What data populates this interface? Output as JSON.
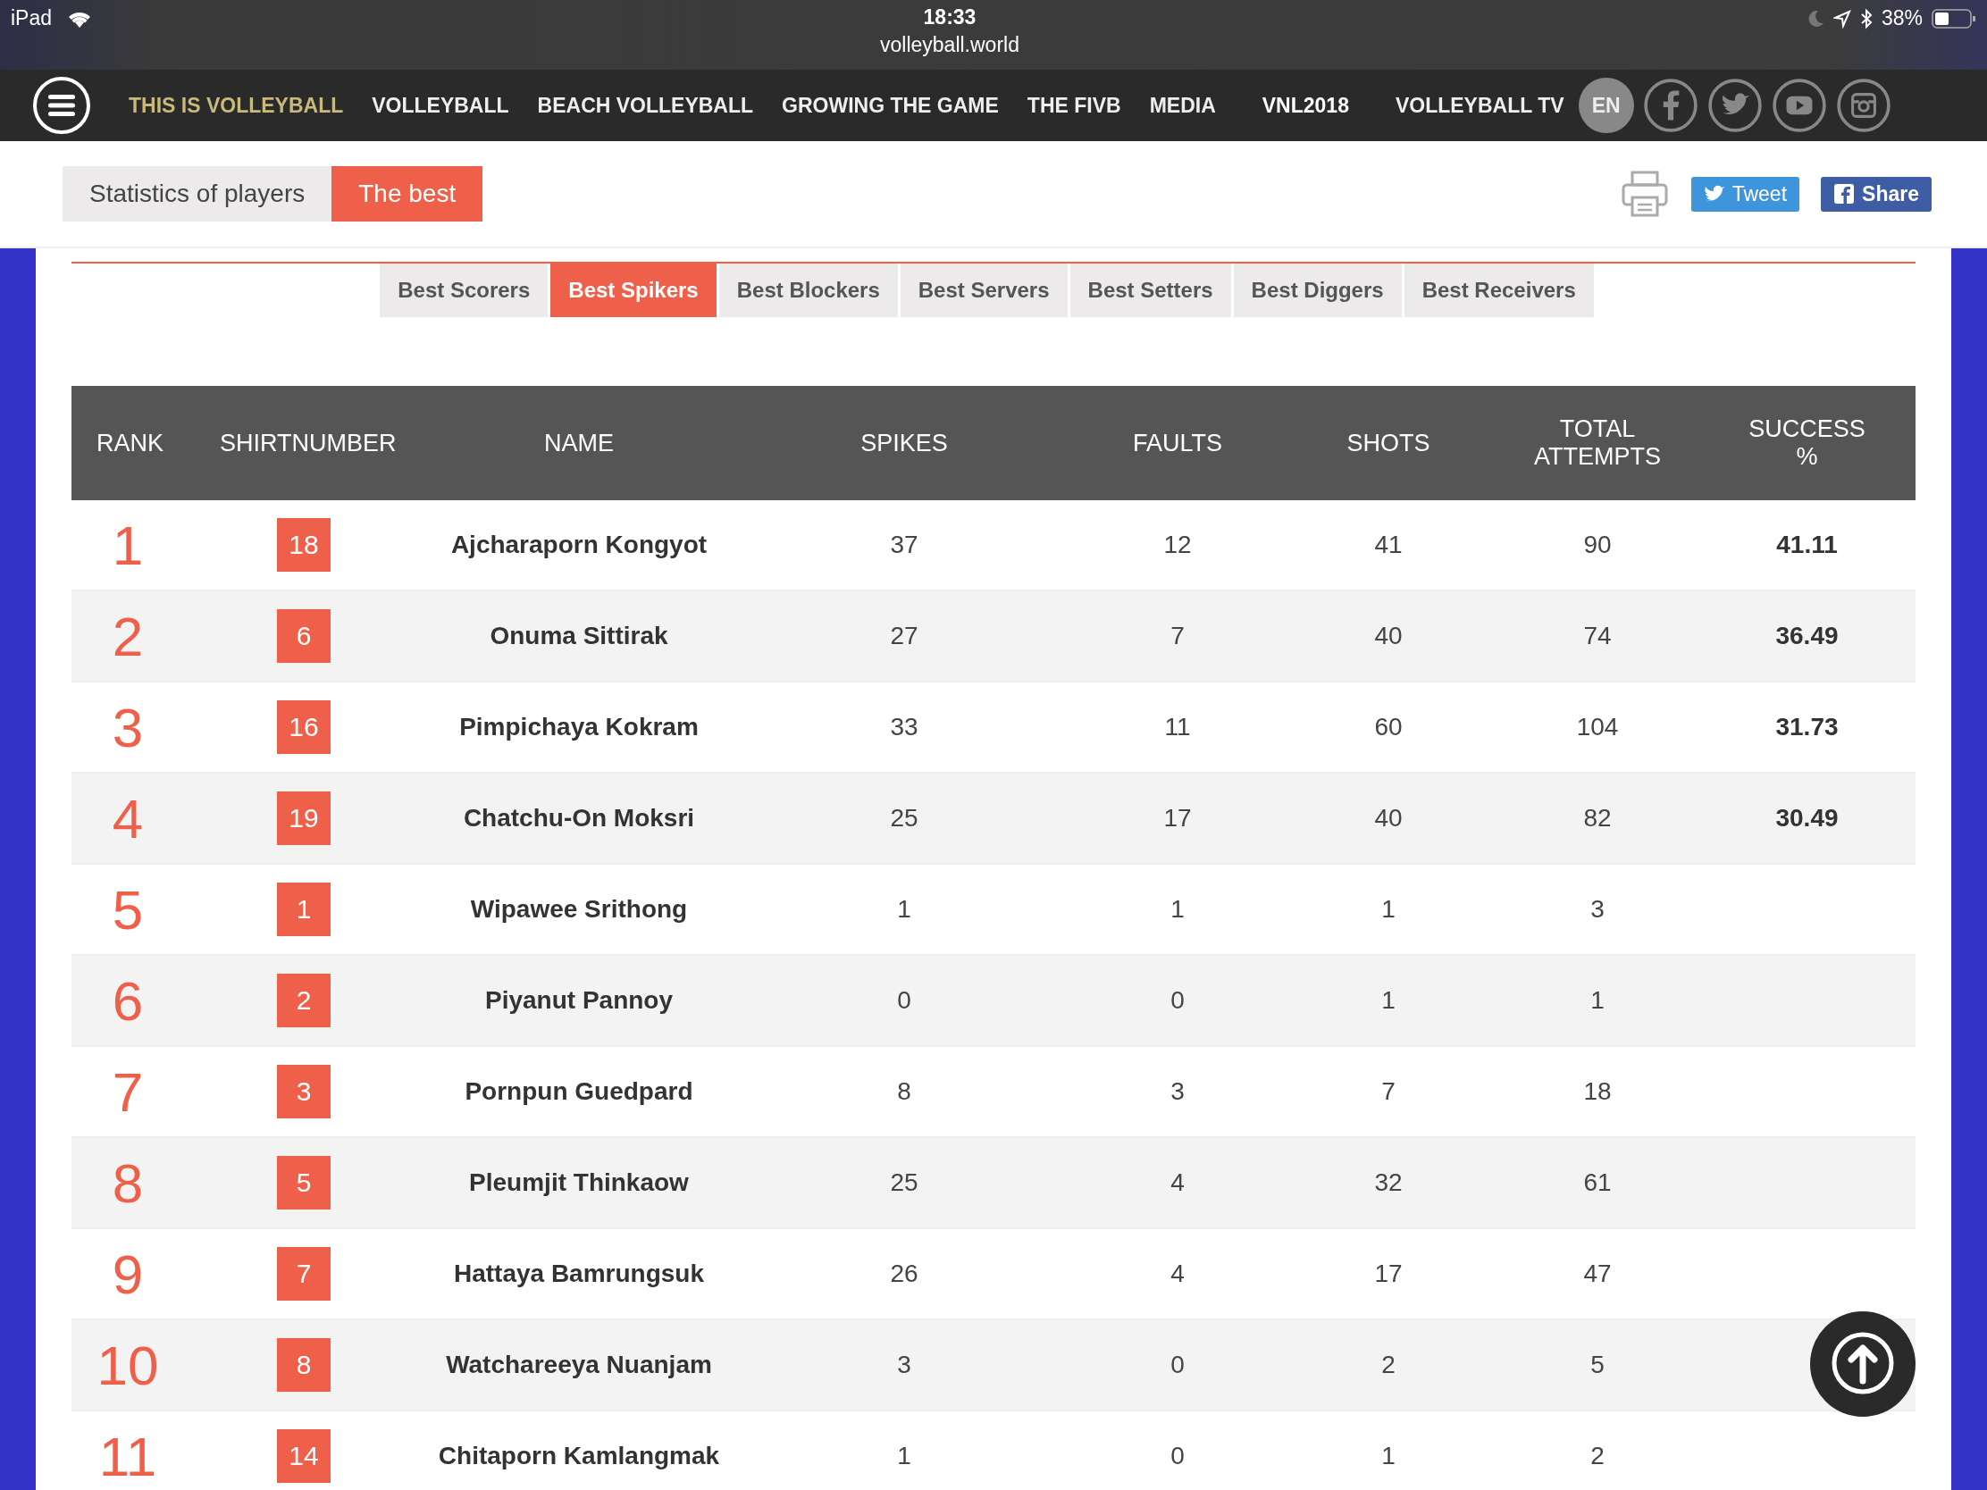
{
  "status_bar": {
    "device": "iPad",
    "time": "18:33",
    "url": "volleyball.world",
    "battery": "38%"
  },
  "nav": {
    "logo": "THIS IS VOLLEYBALL",
    "items": [
      "VOLLEYBALL",
      "BEACH VOLLEYBALL",
      "GROWING THE GAME",
      "THE FIVB",
      "MEDIA",
      "VNL2018",
      "VOLLEYBALL TV"
    ],
    "language": "EN"
  },
  "sections": [
    {
      "label": "Statistics of players",
      "selected": false
    },
    {
      "label": "The best",
      "selected": true
    }
  ],
  "share": {
    "tweet": "Tweet",
    "share": "Share"
  },
  "tabs": [
    {
      "label": "Best Scorers",
      "selected": false
    },
    {
      "label": "Best Spikers",
      "selected": true
    },
    {
      "label": "Best Blockers",
      "selected": false
    },
    {
      "label": "Best Servers",
      "selected": false
    },
    {
      "label": "Best Setters",
      "selected": false
    },
    {
      "label": "Best Diggers",
      "selected": false
    },
    {
      "label": "Best Receivers",
      "selected": false
    }
  ],
  "table": {
    "columns": [
      "RANK",
      "SHIRTNUMBER",
      "NAME",
      "SPIKES",
      "FAULTS",
      "SHOTS",
      "TOTAL ATTEMPTS",
      "SUCCESS %"
    ],
    "rows": [
      {
        "rank": "1",
        "shirt": "18",
        "name": "Ajcharaporn Kongyot",
        "spikes": "37",
        "faults": "12",
        "shots": "41",
        "total": "90",
        "success": "41.11"
      },
      {
        "rank": "2",
        "shirt": "6",
        "name": "Onuma Sittirak",
        "spikes": "27",
        "faults": "7",
        "shots": "40",
        "total": "74",
        "success": "36.49"
      },
      {
        "rank": "3",
        "shirt": "16",
        "name": "Pimpichaya Kokram",
        "spikes": "33",
        "faults": "11",
        "shots": "60",
        "total": "104",
        "success": "31.73"
      },
      {
        "rank": "4",
        "shirt": "19",
        "name": "Chatchu-On Moksri",
        "spikes": "25",
        "faults": "17",
        "shots": "40",
        "total": "82",
        "success": "30.49"
      },
      {
        "rank": "5",
        "shirt": "1",
        "name": "Wipawee Srithong",
        "spikes": "1",
        "faults": "1",
        "shots": "1",
        "total": "3"
      },
      {
        "rank": "6",
        "shirt": "2",
        "name": "Piyanut Pannoy",
        "spikes": "0",
        "faults": "0",
        "shots": "1",
        "total": "1"
      },
      {
        "rank": "7",
        "shirt": "3",
        "name": "Pornpun Guedpard",
        "spikes": "8",
        "faults": "3",
        "shots": "7",
        "total": "18"
      },
      {
        "rank": "8",
        "shirt": "5",
        "name": "Pleumjit Thinkaow",
        "spikes": "25",
        "faults": "4",
        "shots": "32",
        "total": "61"
      },
      {
        "rank": "9",
        "shirt": "7",
        "name": "Hattaya Bamrungsuk",
        "spikes": "26",
        "faults": "4",
        "shots": "17",
        "total": "47"
      },
      {
        "rank": "10",
        "shirt": "8",
        "name": "Watchareeya Nuanjam",
        "spikes": "3",
        "faults": "0",
        "shots": "2",
        "total": "5"
      },
      {
        "rank": "11",
        "shirt": "14",
        "name": "Chitaporn Kamlangmak",
        "spikes": "1",
        "faults": "0",
        "shots": "1",
        "total": "2"
      }
    ]
  }
}
